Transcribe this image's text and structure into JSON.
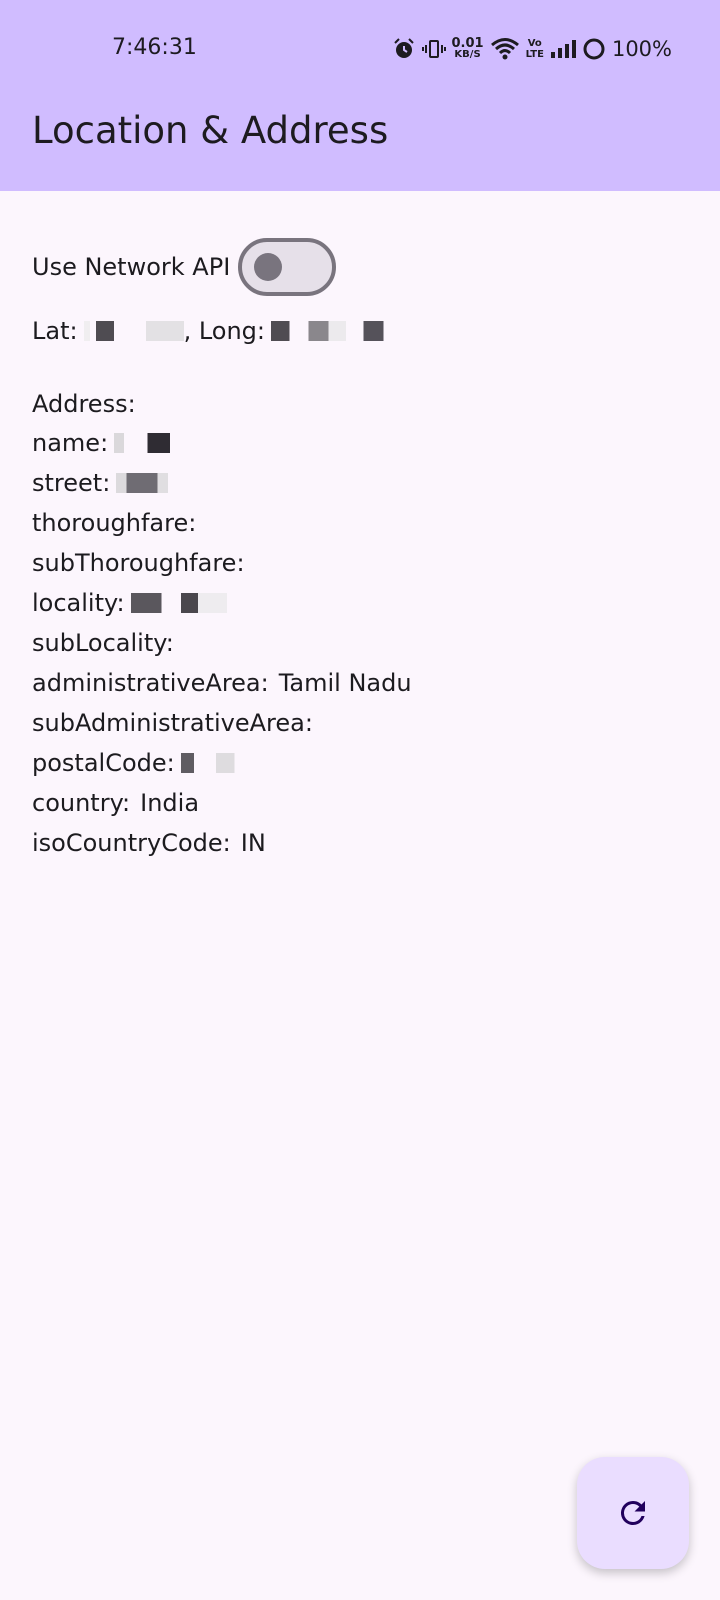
{
  "status_bar": {
    "time": "7:46:31",
    "net_speed_value": "0.01",
    "net_speed_unit": "KB/S",
    "volte_top": "Vo",
    "volte_bottom": "LTE",
    "battery": "100%",
    "icons": [
      "alarm-icon",
      "vibrate-icon",
      "wifi-icon",
      "volte-icon",
      "signal-icon",
      "battery-icon"
    ]
  },
  "app_bar": {
    "title": "Location & Address",
    "color": "#d0bcff"
  },
  "toggle": {
    "label": "Use Network API",
    "state": "off"
  },
  "coords": {
    "lat_label": "Lat:",
    "long_label": ", Long:"
  },
  "address": {
    "header": "Address:",
    "name_label": "name:",
    "street_label": "street:",
    "thoroughfare_label": "thoroughfare:",
    "subthoroughfare_label": "subThoroughfare:",
    "locality_label": "locality:",
    "sublocality_label": "subLocality:",
    "admin_area_label": "administrativeArea:",
    "admin_area_value": "Tamil Nadu",
    "sub_admin_area_label": "subAdministrativeArea:",
    "postal_code_label": "postalCode:",
    "country_label": "country:",
    "country_value": "India",
    "iso_country_code_label": "isoCountryCode:",
    "iso_country_code_value": "IN"
  },
  "fab": {
    "icon": "refresh-icon",
    "color": "#eaddff"
  }
}
